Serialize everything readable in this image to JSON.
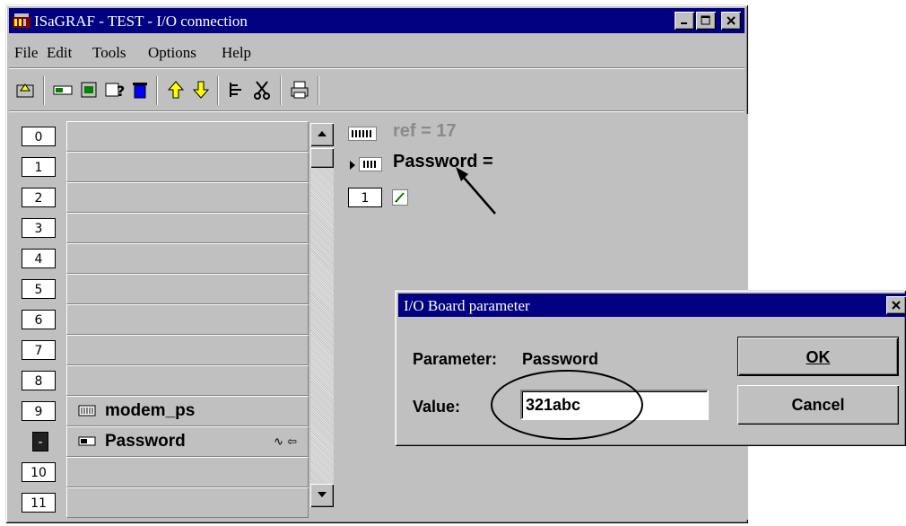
{
  "window": {
    "title": "ISaGRAF - TEST - I/O connection",
    "min_label": "_",
    "max_label": "□",
    "close_label": "✕"
  },
  "menu": [
    "File",
    "Edit",
    "Tools",
    "Options",
    "Help"
  ],
  "toolbar_icons": [
    "open-board-icon",
    "connect-icon",
    "board-icon",
    "params-icon",
    "delete-icon",
    "up-arrow-icon",
    "down-arrow-icon",
    "tree-icon",
    "cut-icon",
    "print-icon"
  ],
  "slots": [
    {
      "num": "0",
      "label": ""
    },
    {
      "num": "1",
      "label": ""
    },
    {
      "num": "2",
      "label": ""
    },
    {
      "num": "3",
      "label": ""
    },
    {
      "num": "4",
      "label": ""
    },
    {
      "num": "5",
      "label": ""
    },
    {
      "num": "6",
      "label": ""
    },
    {
      "num": "7",
      "label": ""
    },
    {
      "num": "8",
      "label": ""
    },
    {
      "num": "9",
      "label": "modem_ps"
    },
    {
      "num": "-",
      "label": "Password"
    },
    {
      "num": "10",
      "label": ""
    },
    {
      "num": "11",
      "label": ""
    }
  ],
  "right_panel": {
    "ref_text": "ref = 17",
    "param_text": "Password =",
    "channel_num": "1"
  },
  "dialog": {
    "title": "I/O Board parameter",
    "parameter_label": "Parameter:",
    "parameter_value": "Password",
    "value_label": "Value:",
    "value_input": "321abc",
    "ok_label": "OK",
    "cancel_label": "Cancel",
    "close_label": "✕"
  }
}
